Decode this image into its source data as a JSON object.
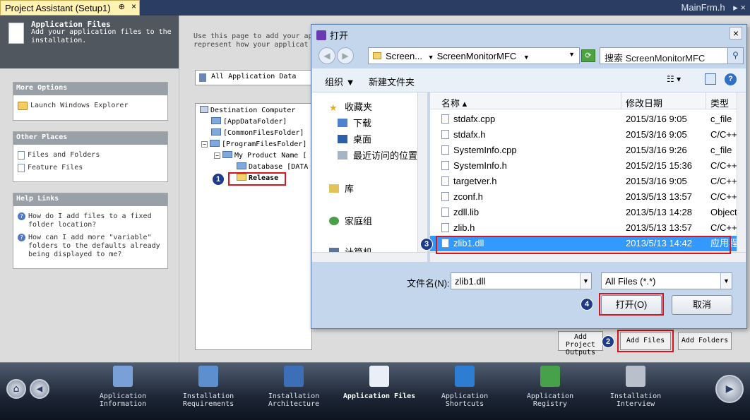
{
  "window": {
    "tab_title": "Project Assistant (Setup1)",
    "tab_pin": "⊕",
    "tab_close": "×",
    "right_title": "MainFrm.h",
    "right_controls": "▸ ×"
  },
  "left": {
    "header_title": "Application Files",
    "header_desc": "Add your application files to the installation.",
    "more_options": {
      "title": "More Options",
      "items": [
        "Launch Windows Explorer"
      ]
    },
    "other_places": {
      "title": "Other Places",
      "items": [
        "Files and Folders",
        "Feature Files"
      ]
    },
    "help_links": {
      "title": "Help Links",
      "items": [
        "How do I add files to a fixed folder location?",
        "How can I add more \"variable\" folders to the defaults already being displayed to me?"
      ]
    }
  },
  "main": {
    "description": "Use this page to add your ap represent how your applicat",
    "combo_value": "All Application Data",
    "tree": [
      "Destination Computer",
      "[AppDataFolder]",
      "[CommonFilesFolder]",
      "[ProgramFilesFolder]",
      "My Product Name [",
      "Database [DATA",
      "Release"
    ],
    "buttons": {
      "add_project_outputs": "Add Project Outputs",
      "add_files": "Add Files",
      "add_folders": "Add Folders"
    }
  },
  "badges": [
    "1",
    "2",
    "3",
    "4"
  ],
  "dialog": {
    "title": "打开",
    "close": "×",
    "back": "◀",
    "forward": "▶",
    "path": [
      "Screen...",
      "ScreenMonitorMFC"
    ],
    "path_sep": "▼",
    "search_placeholder": "搜索 ScreenMonitorMFC",
    "toolbar": {
      "organize": "组织 ▼",
      "new_folder": "新建文件夹",
      "help": "?"
    },
    "nav": [
      "收藏夹",
      "下载",
      "桌面",
      "最近访问的位置",
      "库",
      "家庭组",
      "计算机"
    ],
    "columns": [
      "名称",
      "修改日期",
      "类型"
    ],
    "files": [
      {
        "name": "stdafx.cpp",
        "date": "2015/3/16 9:05",
        "type": "c_file"
      },
      {
        "name": "stdafx.h",
        "date": "2015/3/16 9:05",
        "type": "C/C++"
      },
      {
        "name": "SystemInfo.cpp",
        "date": "2015/3/16 9:26",
        "type": "c_file"
      },
      {
        "name": "SystemInfo.h",
        "date": "2015/2/15 15:36",
        "type": "C/C++"
      },
      {
        "name": "targetver.h",
        "date": "2015/3/16 9:05",
        "type": "C/C++"
      },
      {
        "name": "zconf.h",
        "date": "2013/5/13 13:57",
        "type": "C/C++"
      },
      {
        "name": "zdll.lib",
        "date": "2013/5/13 14:28",
        "type": "Object"
      },
      {
        "name": "zlib.h",
        "date": "2013/5/13 13:57",
        "type": "C/C++"
      },
      {
        "name": "zlib1.dll",
        "date": "2013/5/13 14:42",
        "type": "应用程"
      }
    ],
    "selected_index": 8,
    "filename_label": "文件名(N):",
    "filename_value": "zlib1.dll",
    "filetype_value": "All Files (*.*)",
    "open_label": "打开(O)",
    "cancel_label": "取消"
  },
  "bottom_nav": [
    "Application Information",
    "Installation Requirements",
    "Installation Architecture",
    "Application Files",
    "Application Shortcuts",
    "Application Registry",
    "Installation Interview"
  ],
  "bottom_active_index": 3,
  "colors": {
    "title_bar": "#2b3d63",
    "selected_row": "#3399ff",
    "highlight_box": "#d6131f",
    "badge": "#1d3b8c"
  }
}
